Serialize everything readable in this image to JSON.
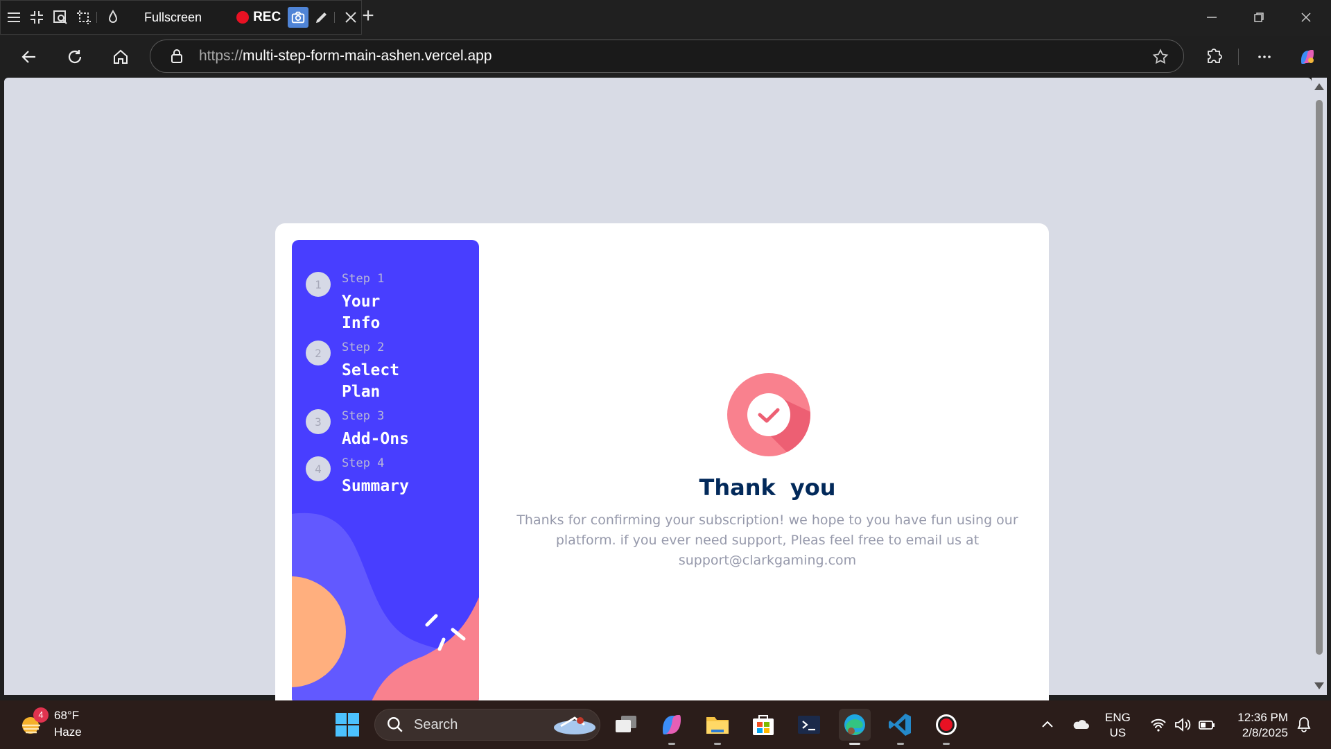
{
  "recorder_toolbar": {
    "fullscreen_label": "Fullscreen",
    "rec_label": "REC"
  },
  "browser": {
    "url_scheme": "https://",
    "url_host": "multi-step-form-main-ashen.vercel.app"
  },
  "form": {
    "steps": [
      {
        "number": "1",
        "label": "Step 1",
        "title": "Your Info"
      },
      {
        "number": "2",
        "label": "Step 2",
        "title": "Select Plan"
      },
      {
        "number": "3",
        "label": "Step 3",
        "title": "Add-Ons"
      },
      {
        "number": "4",
        "label": "Step 4",
        "title": "Summary"
      }
    ],
    "thanks_title": "Thank  you",
    "thanks_message": "Thanks for confirming your subscription! we hope to you have fun using our platform. if you ever need support, Pleas feel free to email us at support@clarkgaming.com"
  },
  "colors": {
    "sidebar": "#483eff",
    "denim": "#02295a",
    "accent_pink": "#f9818e",
    "accent_orange": "#ffaf7e"
  },
  "taskbar": {
    "weather_temp": "68°F",
    "weather_desc": "Haze",
    "weather_badge": "4",
    "search_label": "Search",
    "lang_top": "ENG",
    "lang_bottom": "US",
    "time": "12:36 PM",
    "date": "2/8/2025"
  }
}
